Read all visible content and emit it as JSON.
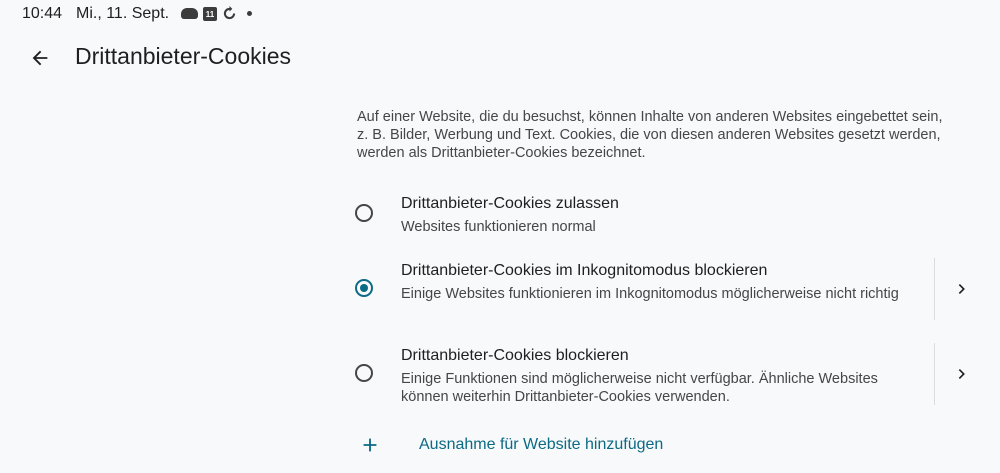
{
  "status_bar": {
    "time": "10:44",
    "date": "Mi., 11. Sept.",
    "icons": [
      "cloud-icon",
      "calendar-icon",
      "sync-icon",
      "notification-dot-icon"
    ],
    "calendar_day": "11"
  },
  "app_bar": {
    "back_icon": "arrow-back-icon",
    "title": "Drittanbieter-Cookies"
  },
  "description": "Auf einer Website, die du besuchst, können Inhalte von anderen Websites eingebettet sein, z. B. Bilder, Werbung und Text. Cookies, die von diesen anderen Websites gesetzt werden, werden als Drittanbieter-Cookies bezeichnet.",
  "options": [
    {
      "title": "Drittanbieter-Cookies zulassen",
      "subtitle": "Websites funktionieren normal",
      "selected": false,
      "has_details": false
    },
    {
      "title": "Drittanbieter-Cookies im Inkognitomodus blockieren",
      "subtitle": "Einige Websites funktionieren im Inkognitomodus möglicherweise nicht richtig",
      "selected": true,
      "has_details": true
    },
    {
      "title": "Drittanbieter-Cookies blockieren",
      "subtitle": "Einige Funktionen sind möglicherweise nicht verfügbar. Ähnliche Websites können weiterhin Drittanbieter-Cookies verwenden.",
      "selected": false,
      "has_details": true
    }
  ],
  "add_exception": {
    "icon": "plus-icon",
    "label": "Ausnahme für Website hinzufügen"
  },
  "colors": {
    "accent": "#0b6a84",
    "background": "#f8f9fb",
    "text_primary": "#1f1f1f",
    "text_secondary": "#444746"
  }
}
